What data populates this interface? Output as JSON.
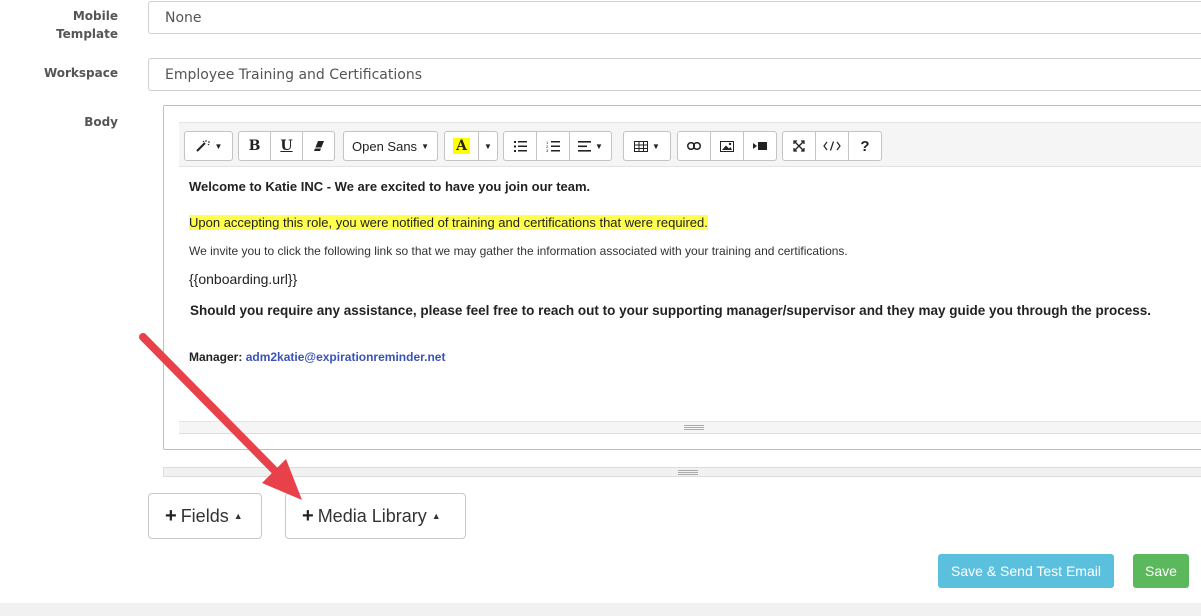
{
  "form": {
    "mobile_template": {
      "label": "Mobile Template",
      "value": "None"
    },
    "workspace": {
      "label": "Workspace",
      "value": "Employee Training and Certifications"
    },
    "body": {
      "label": "Body"
    }
  },
  "toolbar": {
    "font_name": "Open Sans",
    "highlight_letter": "A",
    "help": "?",
    "bold": "B",
    "underline": "U"
  },
  "email": {
    "line1": "Welcome to Katie INC - We are excited to have you join our team.",
    "line2": "Upon accepting this role, you were notified of training and certifications that were required.",
    "line3": "We invite you to click the following link so that we may gather the information associated with your training and certifications.",
    "line4": "{{onboarding.url}}",
    "line5": "Should you require any assistance, please feel free to reach out to your supporting manager/supervisor and they may guide you through the process.",
    "manager_label": "Manager:",
    "manager_email": "adm2katie@expirationreminder.net"
  },
  "buttons": {
    "fields": "Fields",
    "media_library": "Media Library",
    "save_send_test": "Save & Send Test Email",
    "save": "Save"
  },
  "colors": {
    "highlight": "#ffff4d",
    "link": "#3a52b8",
    "info_button": "#5bc0de",
    "success_button": "#5cb85c",
    "annotation_arrow": "#e8414a"
  }
}
